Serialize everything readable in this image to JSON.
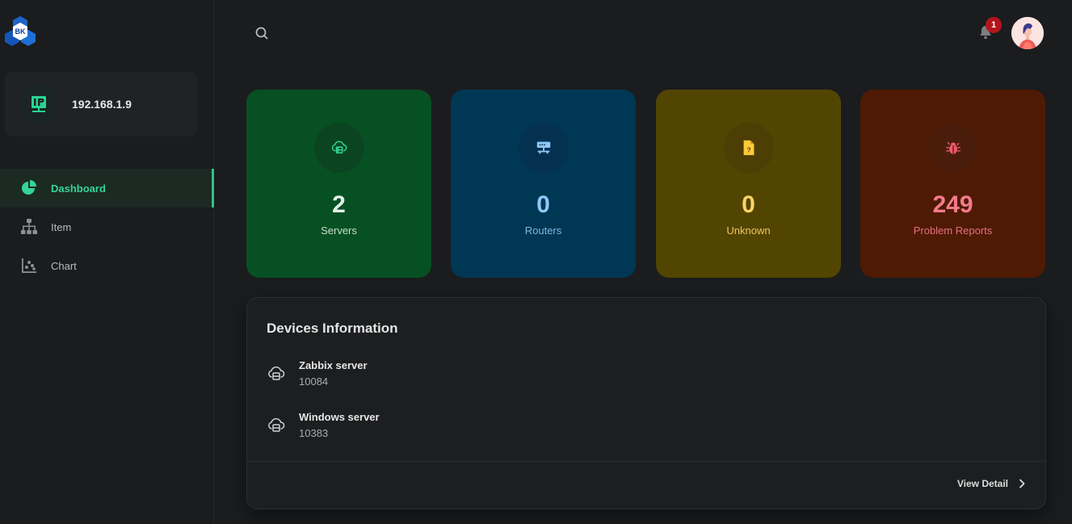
{
  "brand": {
    "logo_text": "BK",
    "icon": "hexagon-logo-icon"
  },
  "sidebar": {
    "ip_card": {
      "icon": "ip-network-icon",
      "address": "192.168.1.9"
    },
    "nav": [
      {
        "label": "Dashboard",
        "icon": "pie-chart-icon",
        "active": true
      },
      {
        "label": "Item",
        "icon": "sitemap-icon",
        "active": false
      },
      {
        "label": "Chart",
        "icon": "scatter-chart-icon",
        "active": false
      }
    ]
  },
  "header": {
    "search_icon": "search-icon",
    "notifications": {
      "icon": "bell-icon",
      "count": "1"
    },
    "avatar": "user-avatar"
  },
  "stats": [
    {
      "value": "2",
      "label": "Servers",
      "icon": "cloud-server-icon",
      "color": "#075023"
    },
    {
      "value": "0",
      "label": "Routers",
      "icon": "router-icon",
      "color": "#003755"
    },
    {
      "value": "0",
      "label": "Unknown",
      "icon": "unknown-file-icon",
      "color": "#524501"
    },
    {
      "value": "249",
      "label": "Problem Reports",
      "icon": "bug-icon",
      "color": "#4f1a03"
    }
  ],
  "devices": {
    "title": "Devices Information",
    "items": [
      {
        "name": "Zabbix server",
        "id": "10084",
        "icon": "cloud-server-icon"
      },
      {
        "name": "Windows server",
        "id": "10383",
        "icon": "cloud-server-icon"
      }
    ],
    "view_detail": "View Detail"
  }
}
